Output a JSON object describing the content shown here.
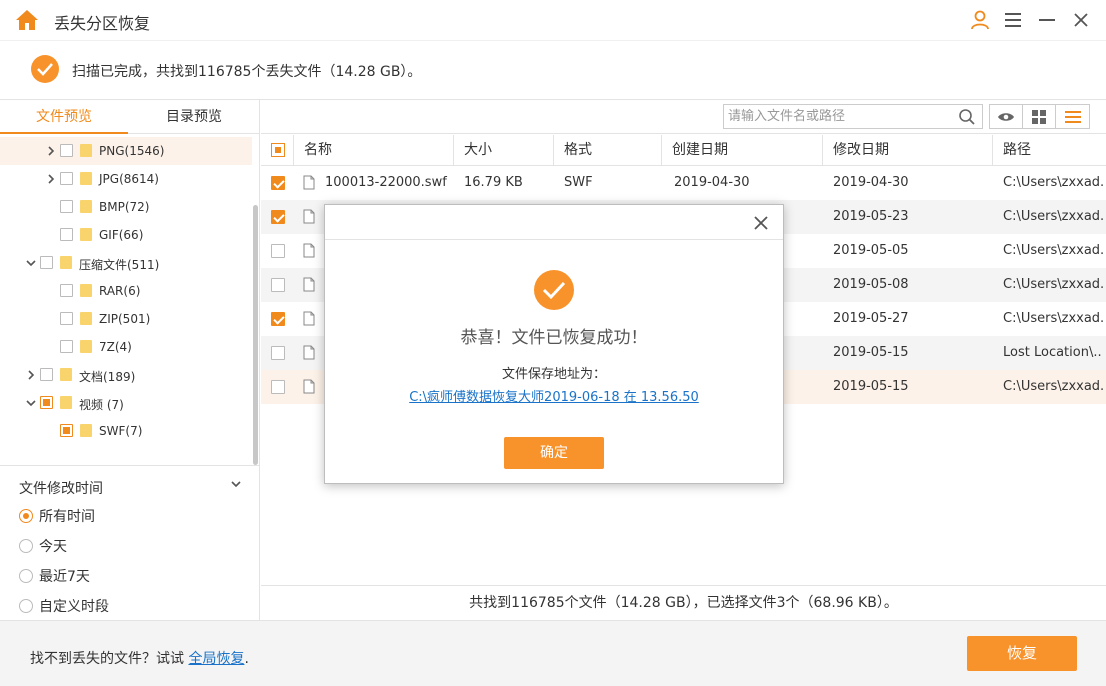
{
  "app": {
    "title": "丢失分区恢复"
  },
  "banner": {
    "text": "扫描已完成，共找到116785个丢失文件（14.28 GB）。"
  },
  "left_tabs": [
    {
      "label": "文件预览",
      "active": true
    },
    {
      "label": "目录预览",
      "active": false
    }
  ],
  "tree": [
    {
      "label": "PNG(1546)",
      "level": 2,
      "arrow": "right",
      "check": "none",
      "highlight": true
    },
    {
      "label": "JPG(8614)",
      "level": 2,
      "arrow": "right",
      "check": "none",
      "highlight": false
    },
    {
      "label": "BMP(72)",
      "level": 2,
      "arrow": "",
      "check": "none",
      "highlight": false
    },
    {
      "label": "GIF(66)",
      "level": 2,
      "arrow": "",
      "check": "none",
      "highlight": false
    },
    {
      "label": "压缩文件(511)",
      "level": 1,
      "arrow": "down",
      "check": "none",
      "highlight": false
    },
    {
      "label": "RAR(6)",
      "level": 2,
      "arrow": "",
      "check": "none",
      "highlight": false
    },
    {
      "label": "ZIP(501)",
      "level": 2,
      "arrow": "",
      "check": "none",
      "highlight": false
    },
    {
      "label": "7Z(4)",
      "level": 2,
      "arrow": "",
      "check": "none",
      "highlight": false
    },
    {
      "label": "文档(189)",
      "level": 1,
      "arrow": "right",
      "check": "none",
      "highlight": false
    },
    {
      "label": "视频 (7)",
      "level": 1,
      "arrow": "down",
      "check": "partial",
      "highlight": false
    },
    {
      "label": "SWF(7)",
      "level": 2,
      "arrow": "",
      "check": "partial",
      "highlight": false
    }
  ],
  "filter": {
    "title": "文件修改时间",
    "options": [
      {
        "label": "所有时间",
        "selected": true
      },
      {
        "label": "今天",
        "selected": false
      },
      {
        "label": "最近7天",
        "selected": false
      },
      {
        "label": "自定义时段",
        "selected": false
      }
    ]
  },
  "search": {
    "placeholder": "请输入文件名或路径"
  },
  "table": {
    "headers": [
      "名称",
      "大小",
      "格式",
      "创建日期",
      "修改日期",
      "路径"
    ],
    "rows": [
      {
        "checked": true,
        "name": "100013-22000.swf",
        "size": "16.79 KB",
        "format": "SWF",
        "created": "2019-04-30",
        "modified": "2019-04-30",
        "path": "C:\\Users\\zxxad...",
        "style": ""
      },
      {
        "checked": true,
        "name": "",
        "size": "",
        "format": "",
        "created": "",
        "modified": "2019-05-23",
        "path": "C:\\Users\\zxxad...",
        "style": "alt"
      },
      {
        "checked": false,
        "name": "",
        "size": "",
        "format": "",
        "created": "",
        "modified": "2019-05-05",
        "path": "C:\\Users\\zxxad...",
        "style": ""
      },
      {
        "checked": false,
        "name": "",
        "size": "",
        "format": "",
        "created": "",
        "modified": "2019-05-08",
        "path": "C:\\Users\\zxxad...",
        "style": "alt"
      },
      {
        "checked": true,
        "name": "",
        "size": "",
        "format": "",
        "created": "",
        "modified": "2019-05-27",
        "path": "C:\\Users\\zxxad...",
        "style": ""
      },
      {
        "checked": false,
        "name": "",
        "size": "",
        "format": "",
        "created": "",
        "modified": "2019-05-15",
        "path": "Lost Location\\...",
        "style": "alt"
      },
      {
        "checked": false,
        "name": "",
        "size": "",
        "format": "",
        "created": "",
        "modified": "2019-05-15",
        "path": "C:\\Users\\zxxad...",
        "style": "hl"
      }
    ]
  },
  "status": {
    "text": "共找到116785个文件（14.28 GB），已选择文件3个（68.96 KB）。"
  },
  "bottom": {
    "prefix": "找不到丢失的文件？试试 ",
    "link": "全局恢复",
    "suffix": ".",
    "recover_label": "恢复"
  },
  "modal": {
    "title": "恭喜！文件已恢复成功！",
    "sub": "文件保存地址为：",
    "path": "C:\\疯师傅数据恢复大师2019-06-18 在 13.56.50",
    "ok_label": "确定"
  },
  "colors": {
    "accent": "#f08a1c",
    "button": "#f8922a",
    "link": "#1a73c8"
  },
  "icons": [
    "home-icon",
    "user-icon",
    "menu-icon",
    "minimize-icon",
    "close-icon",
    "check-circle-icon",
    "search-icon",
    "eye-icon",
    "grid-icon",
    "list-icon",
    "file-icon",
    "folder-icon"
  ]
}
